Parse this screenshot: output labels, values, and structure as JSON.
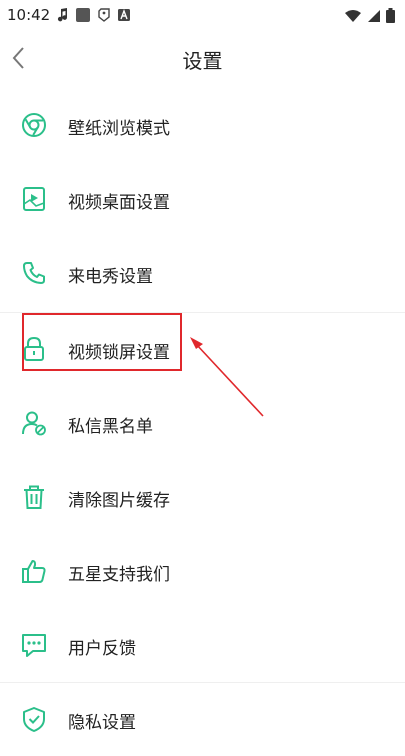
{
  "status_bar": {
    "time": "10:42"
  },
  "header": {
    "title": "设置"
  },
  "menu": {
    "items": [
      {
        "label": "壁纸浏览模式",
        "icon": "chrome-circle-icon"
      },
      {
        "label": "视频桌面设置",
        "icon": "video-frame-icon"
      },
      {
        "label": "来电秀设置",
        "icon": "phone-icon"
      },
      {
        "label": "视频锁屏设置",
        "icon": "lock-icon"
      },
      {
        "label": "私信黑名单",
        "icon": "user-block-icon"
      },
      {
        "label": "清除图片缓存",
        "icon": "trash-icon"
      },
      {
        "label": "五星支持我们",
        "icon": "thumbs-up-icon"
      },
      {
        "label": "用户反馈",
        "icon": "chat-bubble-icon"
      },
      {
        "label": "隐私设置",
        "icon": "shield-check-icon"
      }
    ]
  },
  "colors": {
    "accent": "#2bbf8a",
    "annotation": "#e0282c"
  }
}
